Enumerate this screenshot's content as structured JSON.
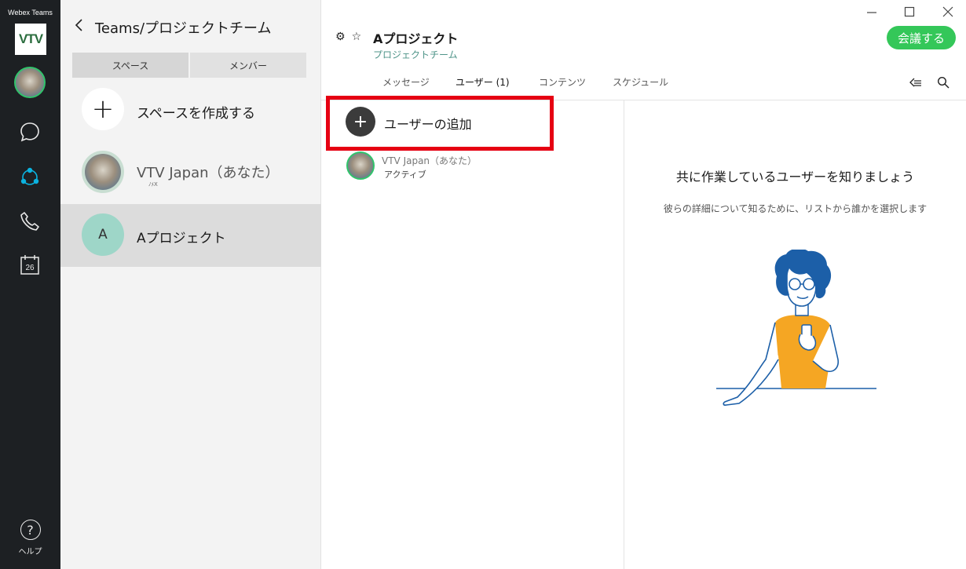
{
  "app": {
    "name": "Webex Teams",
    "logo_text": "VTV"
  },
  "rail": {
    "calendar_day": "26",
    "help_label": "ヘルプ",
    "help_symbol": "?"
  },
  "panel": {
    "title": "Teams/プロジェクトチーム",
    "segments": [
      "スペース",
      "メンバー"
    ],
    "create_label": "スペースを作成する",
    "items": [
      {
        "name": "VTV Japan（あなた）",
        "sub": "ﾉﾒX"
      },
      {
        "name": "Aプロジェクト",
        "initial": "A"
      }
    ]
  },
  "header": {
    "title": "Aプロジェクト",
    "subtitle": "プロジェクトチーム",
    "meet_button": "会議する",
    "tabs": [
      "メッセージ",
      "ユーザー (1)",
      "コンテンツ",
      "スケジュール"
    ],
    "active_tab": "ユーザー (1)"
  },
  "users": {
    "add_label": "ユーザーの追加",
    "members": [
      {
        "name": "VTV Japan（あなた）",
        "status": "アクティブ"
      }
    ]
  },
  "empty_state": {
    "title": "共に作業しているユーザーを知りましょう",
    "subtitle": "彼らの詳細について知るために、リストから誰かを選択します"
  },
  "colors": {
    "accent_green": "#34c759",
    "highlight_red": "#e60012",
    "rail_bg": "#1d2023",
    "link_teal": "#4f9489"
  }
}
